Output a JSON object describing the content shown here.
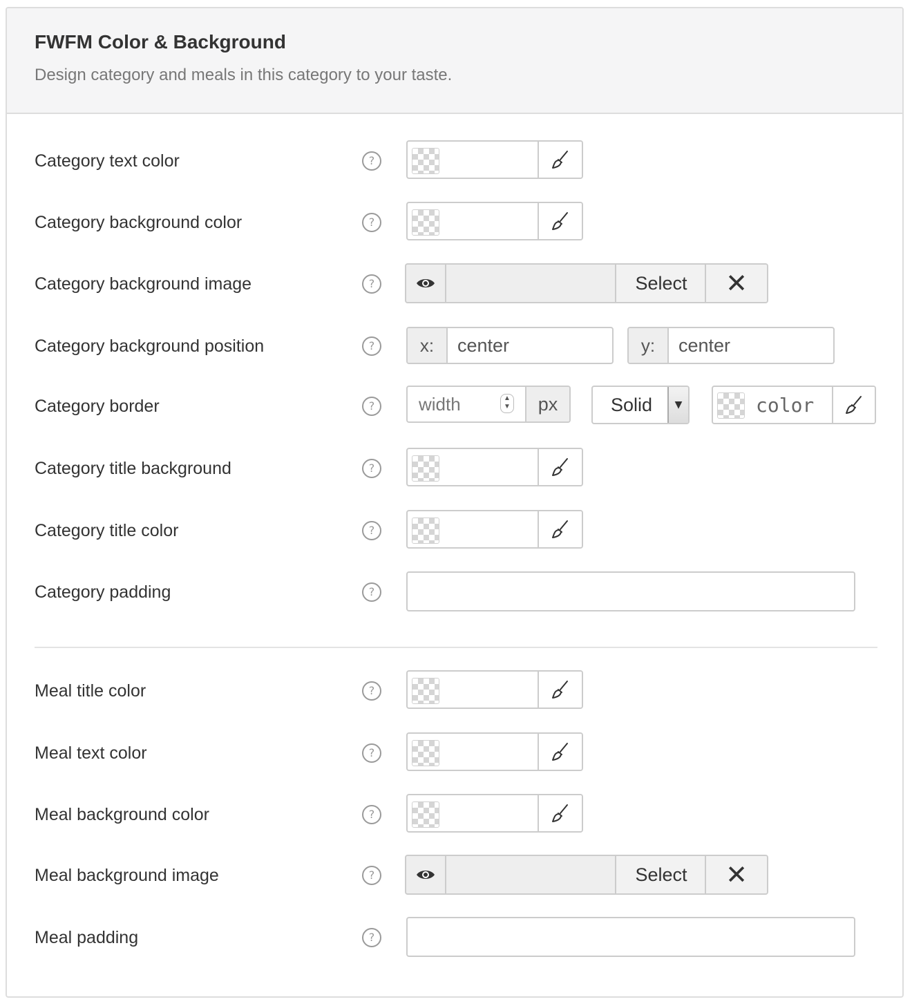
{
  "panel": {
    "title": "FWFM Color & Background",
    "description": "Design category and meals in this category to your taste."
  },
  "help_icon_glyph": "?",
  "fields": {
    "category_text_color": {
      "label": "Category text color"
    },
    "category_background_color": {
      "label": "Category background color"
    },
    "category_background_image": {
      "label": "Category background image",
      "select_label": "Select",
      "clear_label": "✕"
    },
    "category_background_position": {
      "label": "Category background position",
      "x_label": "x:",
      "x_value": "center",
      "y_label": "y:",
      "y_value": "center"
    },
    "category_border": {
      "label": "Category border",
      "width_placeholder": "width",
      "unit": "px",
      "style_value": "Solid",
      "color_placeholder": "color"
    },
    "category_title_background": {
      "label": "Category title background"
    },
    "category_title_color": {
      "label": "Category title color"
    },
    "category_padding": {
      "label": "Category padding",
      "value": ""
    },
    "meal_title_color": {
      "label": "Meal title color"
    },
    "meal_text_color": {
      "label": "Meal text color"
    },
    "meal_background_color": {
      "label": "Meal background color"
    },
    "meal_background_image": {
      "label": "Meal background image",
      "select_label": "Select",
      "clear_label": "✕"
    },
    "meal_padding": {
      "label": "Meal padding",
      "value": ""
    }
  },
  "icons": {
    "color_picker": "brush-icon",
    "preview": "eye-icon",
    "help": "question-circle-icon",
    "clear": "close-icon"
  }
}
